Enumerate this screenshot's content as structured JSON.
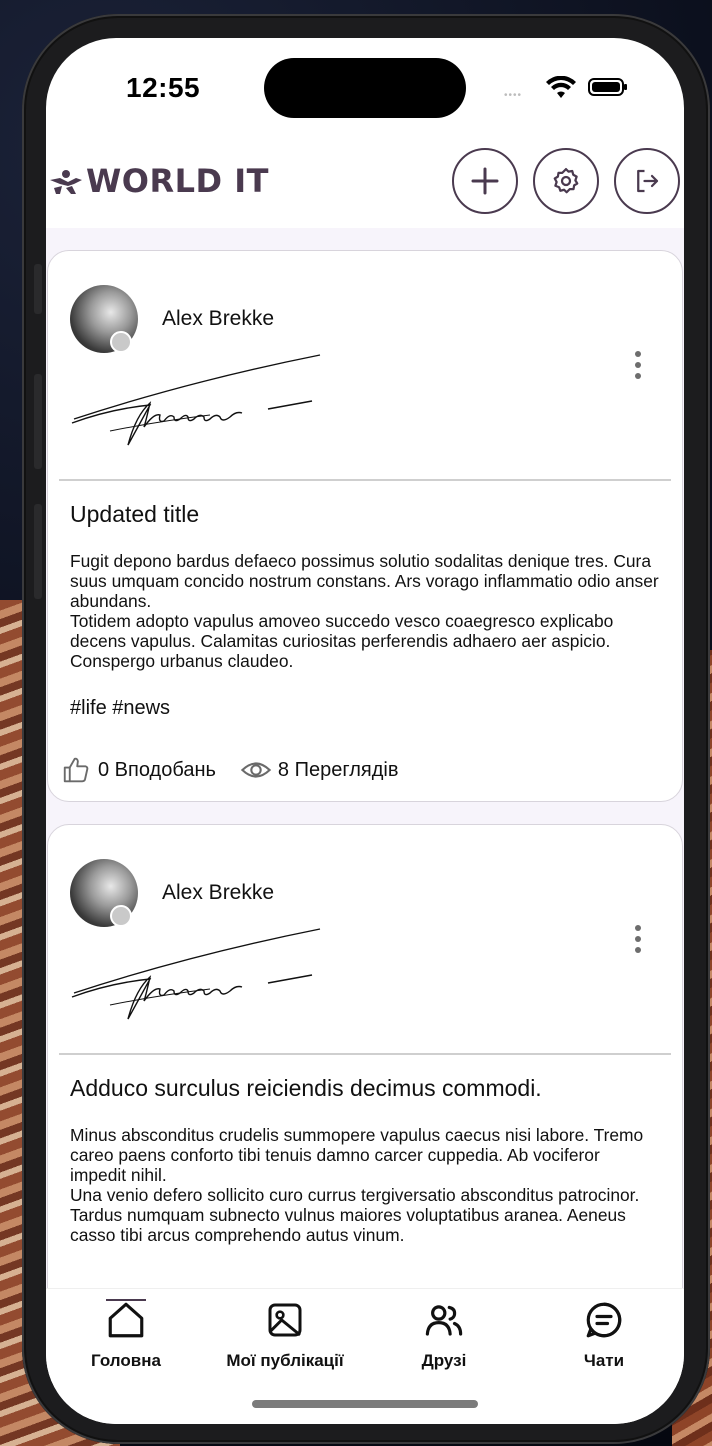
{
  "status_bar": {
    "time": "12:55",
    "signal": "••••"
  },
  "header": {
    "logo_text": "WORLD IT",
    "buttons": [
      {
        "name": "add-button",
        "icon": "plus-icon"
      },
      {
        "name": "settings-button",
        "icon": "gear-icon"
      },
      {
        "name": "logout-button",
        "icon": "logout-icon"
      }
    ],
    "accent_color": "#4a3a4f"
  },
  "posts": [
    {
      "author": "Alex Brekke",
      "title": "Updated title",
      "body": [
        "Fugit depono bardus defaeco possimus solutio sodalitas denique tres. Cura suus umquam concido nostrum constans. Ars vorago inflammatio odio anser abundans.",
        "Totidem adopto vapulus amoveo succedo vesco coaegresco explicabo decens vapulus. Calamitas curiositas perferendis adhaero aer aspicio. Conspergo urbanus claudeo."
      ],
      "tags": "#life #news",
      "likes": "0 Вподобань",
      "views": "8 Переглядів"
    },
    {
      "author": "Alex Brekke",
      "title": "Adduco surculus reiciendis decimus commodi.",
      "body": [
        "Minus absconditus crudelis summopere vapulus caecus nisi labore. Tremo careo paens conforto tibi tenuis damno carcer cuppedia. Ab vociferor impedit nihil.",
        "Una venio defero sollicito curo currus tergiversatio absconditus patrocinor. Tardus numquam subnecto vulnus maiores voluptatibus aranea. Aeneus casso tibi arcus comprehendo autus vinum."
      ]
    }
  ],
  "nav": {
    "items": [
      {
        "label": "Головна",
        "icon": "home-icon",
        "active": true
      },
      {
        "label": "Мої публікації",
        "icon": "image-icon",
        "active": false
      },
      {
        "label": "Друзі",
        "icon": "users-icon",
        "active": false
      },
      {
        "label": "Чати",
        "icon": "chat-icon",
        "active": false
      }
    ]
  }
}
